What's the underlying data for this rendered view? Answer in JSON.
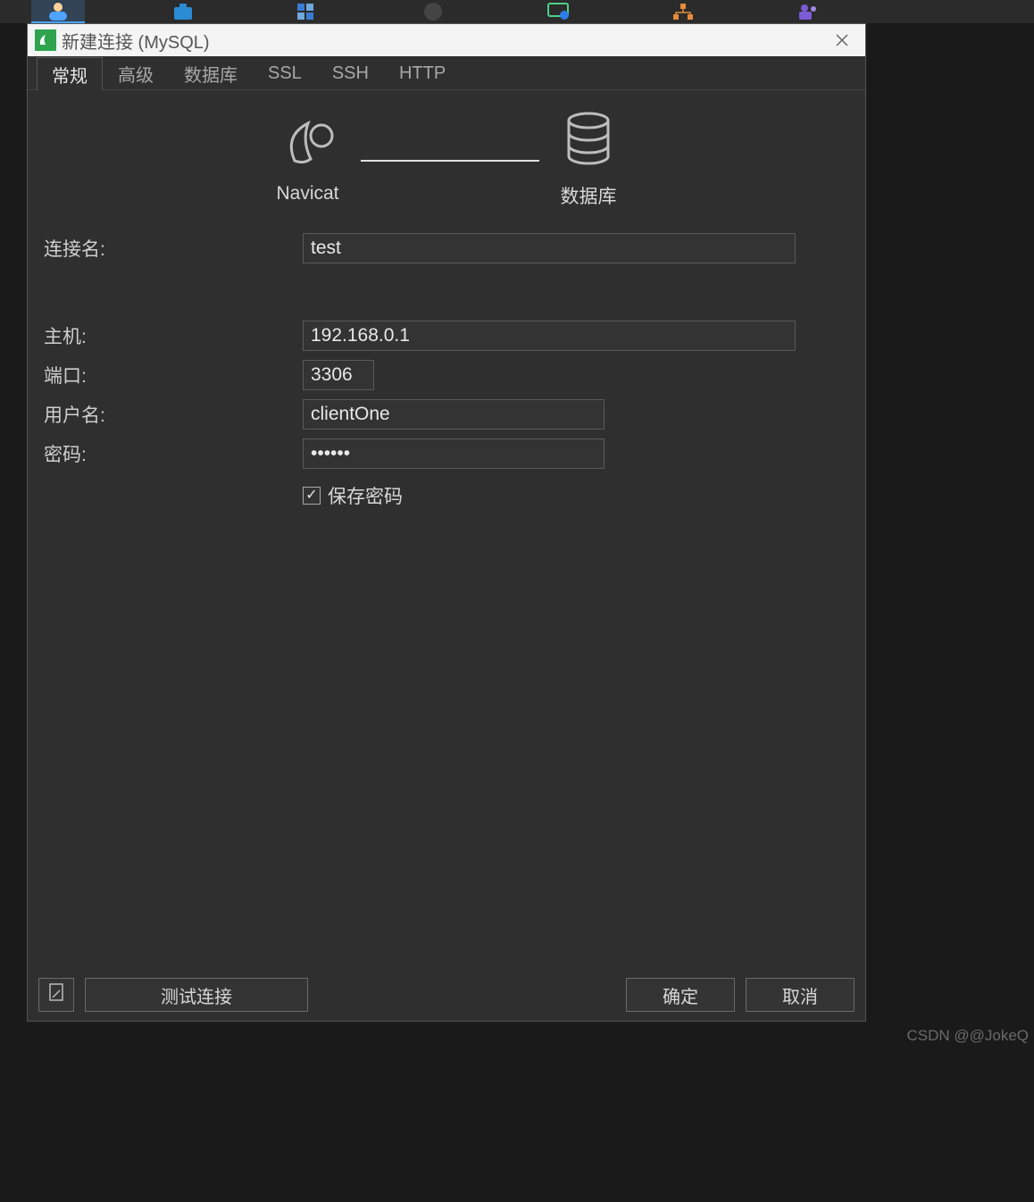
{
  "taskbar": {
    "items": [
      {
        "icon": "person"
      },
      {
        "icon": "briefcase"
      },
      {
        "icon": "apps"
      },
      {
        "icon": "steam"
      },
      {
        "icon": "monitor"
      },
      {
        "icon": "tree"
      },
      {
        "icon": "teams"
      }
    ]
  },
  "dialog": {
    "title": "新建连接 (MySQL)",
    "tabs": [
      "常规",
      "高级",
      "数据库",
      "SSL",
      "SSH",
      "HTTP"
    ],
    "active_tab": 0,
    "diagram": {
      "left_label": "Navicat",
      "right_label": "数据库"
    },
    "form": {
      "connection_name_label": "连接名:",
      "connection_name_value": "test",
      "host_label": "主机:",
      "host_value": "192.168.0.1",
      "port_label": "端口:",
      "port_value": "3306",
      "username_label": "用户名:",
      "username_value": "clientOne",
      "password_label": "密码:",
      "password_value": "••••••",
      "save_password_label": "保存密码",
      "save_password_checked": true
    },
    "footer": {
      "test_label": "测试连接",
      "ok_label": "确定",
      "cancel_label": "取消"
    }
  },
  "watermark": "CSDN @@JokeQ"
}
